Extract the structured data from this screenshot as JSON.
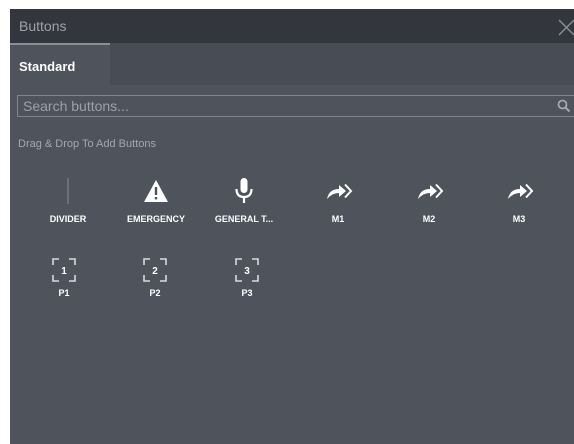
{
  "window": {
    "title": "Buttons"
  },
  "tabs": [
    {
      "label": "Standard"
    }
  ],
  "search": {
    "placeholder": "Search buttons..."
  },
  "hint": "Drag & Drop To Add Buttons",
  "buttons_row1": [
    {
      "label": "DIVIDER",
      "icon": "divider-icon"
    },
    {
      "label": "EMERGENCY",
      "icon": "warning-icon"
    },
    {
      "label": "GENERAL T...",
      "icon": "microphone-icon"
    },
    {
      "label": "M1",
      "icon": "forward-arrow-icon"
    },
    {
      "label": "M2",
      "icon": "forward-arrow-icon"
    },
    {
      "label": "M3",
      "icon": "forward-arrow-icon"
    }
  ],
  "buttons_row2": [
    {
      "label": "P1",
      "icon": "preset-icon",
      "number": "1"
    },
    {
      "label": "P2",
      "icon": "preset-icon",
      "number": "2"
    },
    {
      "label": "P3",
      "icon": "preset-icon",
      "number": "3"
    }
  ],
  "colors": {
    "panel_bg": "#4f535c",
    "titlebar_bg": "#33363c",
    "text_primary": "#ffffff",
    "text_muted": "#a3a7ae"
  }
}
